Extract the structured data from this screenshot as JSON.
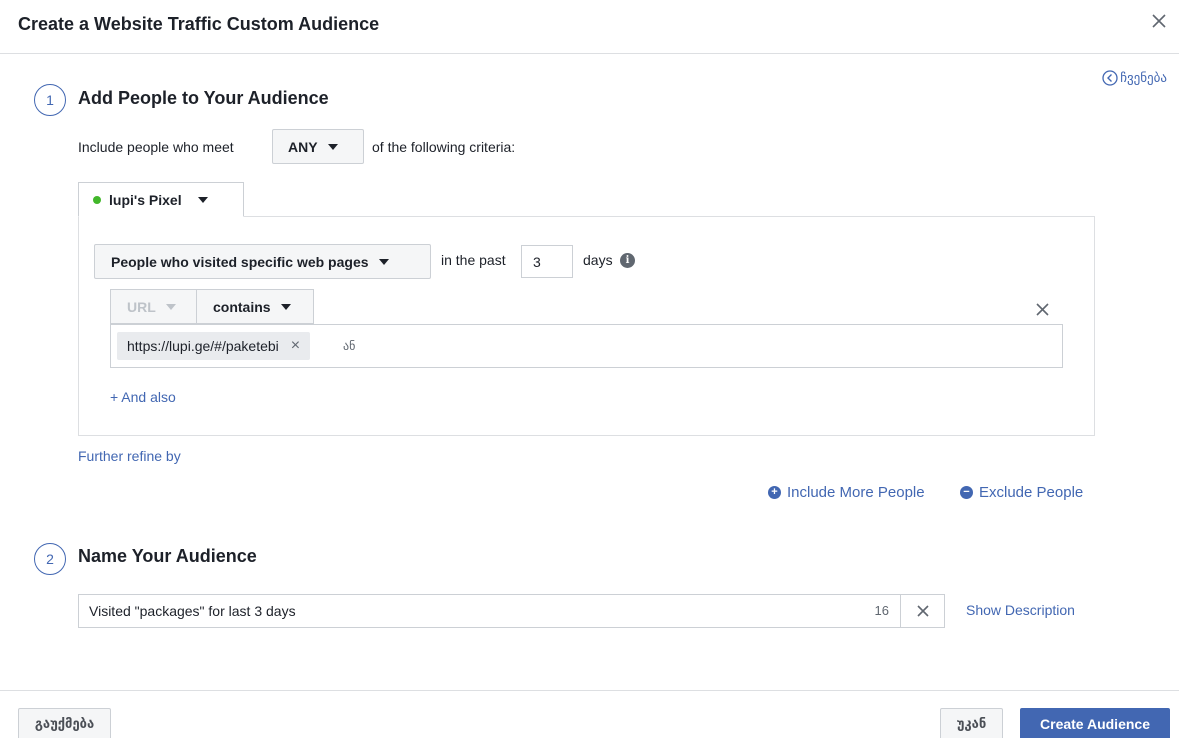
{
  "dialog": {
    "title": "Create a Website Traffic Custom Audience",
    "hide_label": "ჩვენება"
  },
  "step1": {
    "number": "1",
    "title": "Add People to Your Audience",
    "include_prefix": "Include people who meet",
    "match_mode": "ANY",
    "include_suffix": "of the following criteria:",
    "pixel_name": "lupi's Pixel",
    "pixel_status_color": "#42b72a",
    "rule": {
      "type_label": "People who visited specific web pages",
      "in_the_past_label": "in the past",
      "days_value": "3",
      "days_label": "days",
      "field_label": "URL",
      "operator_label": "contains",
      "url_token": "https://lupi.ge/#/paketebi",
      "or_placeholder": "ან"
    },
    "and_also_label": "+ And also",
    "further_refine_label": "Further refine by",
    "include_more_label": "Include More People",
    "exclude_label": "Exclude People"
  },
  "step2": {
    "number": "2",
    "title": "Name Your Audience",
    "name_value": "Visited \"packages\" for last 3 days",
    "char_remaining": "16",
    "show_description_label": "Show Description"
  },
  "footer": {
    "cancel_label": "გაუქმება",
    "back_label": "უკან",
    "create_label": "Create Audience"
  },
  "colors": {
    "accent": "#4267b2",
    "text": "#1d2129",
    "border": "#ccd0d5"
  }
}
